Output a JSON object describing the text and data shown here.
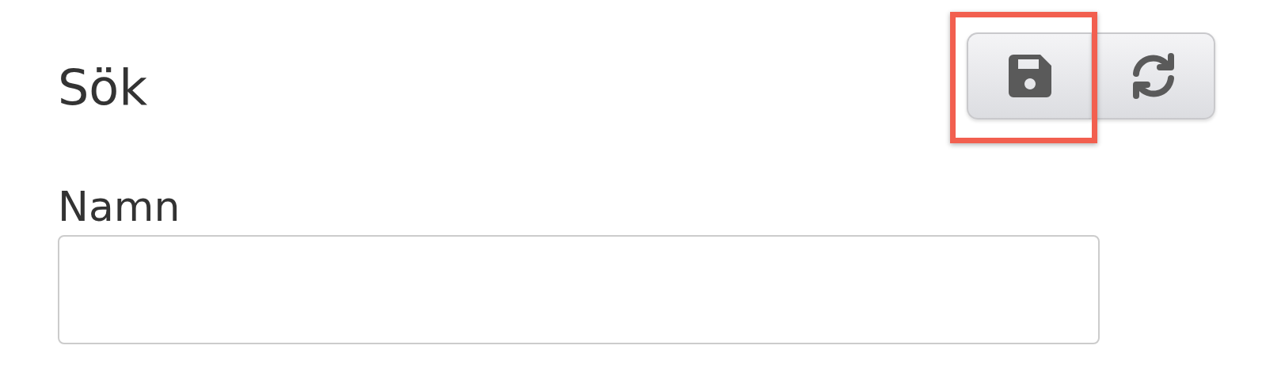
{
  "title": "Sök",
  "toolbar": [
    {
      "kind": "save",
      "highlighted": true
    },
    {
      "kind": "refresh",
      "highlighted": false
    }
  ],
  "fields": [
    {
      "label": "Namn"
    }
  ]
}
